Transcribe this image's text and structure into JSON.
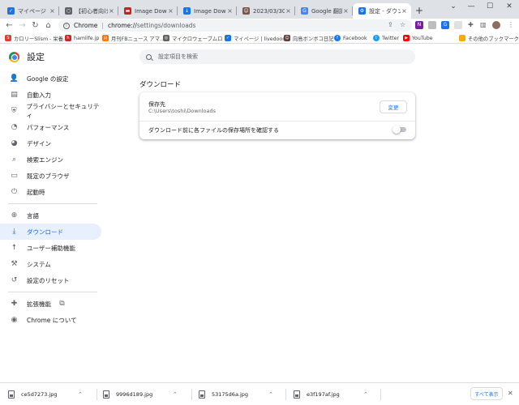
{
  "tabs": [
    {
      "title": "マイページ | live",
      "favicon_color": "#1a73e8",
      "favicon_glyph": "✓"
    },
    {
      "title": "【初心者向け】ロ",
      "favicon_color": "#5f6368",
      "favicon_glyph": "○"
    },
    {
      "title": "Image Downlo",
      "favicon_color": "#c5221f",
      "favicon_glyph": "▬"
    },
    {
      "title": "Image Downlo",
      "favicon_color": "#1a73e8",
      "favicon_glyph": "↓"
    },
    {
      "title": "2023/03/30ー",
      "favicon_color": "#795548",
      "favicon_glyph": "☺"
    },
    {
      "title": "Google 翻訳",
      "favicon_color": "#4285f4",
      "favicon_glyph": "G"
    },
    {
      "title": "設定 - ダウンロ",
      "favicon_color": "#1a73e8",
      "favicon_glyph": "⚙"
    }
  ],
  "toolbar": {
    "scheme": "Chrome",
    "host": "chrome://",
    "path": "settings/downloads",
    "extensions": [
      {
        "color": "#7b1fa2",
        "glyph": "N"
      },
      {
        "color": "#bdbdbd",
        "glyph": ""
      },
      {
        "color": "#1a73e8",
        "glyph": "G"
      },
      {
        "color": "#e0e0e0",
        "glyph": ""
      }
    ]
  },
  "bookmarks": [
    {
      "label": "カロリーSlism - 栄養...",
      "color": "#e53935",
      "glyph": "S"
    },
    {
      "label": "hamlife.jp",
      "color": "#c62828",
      "glyph": "h"
    },
    {
      "label": "月刊FBニュース  アマ...",
      "color": "#ff6f00",
      "glyph": "月"
    },
    {
      "label": "マイクロウェーブムロ -...",
      "color": "#616161",
      "glyph": "◎"
    },
    {
      "label": "マイページ | livedoor...",
      "color": "#1a73e8",
      "glyph": "✓"
    },
    {
      "label": "向島ボンボコ日記",
      "color": "#5d4037",
      "glyph": "☺"
    },
    {
      "label": "Facebook",
      "color": "#1877f2",
      "glyph": "f"
    },
    {
      "label": "Twitter",
      "color": "#1d9bf0",
      "glyph": "t"
    },
    {
      "label": "YouTube",
      "color": "#ff0000",
      "glyph": "▶"
    },
    {
      "label": "その他のブックマーク",
      "color": "#f9ab00",
      "glyph": "■"
    }
  ],
  "settings": {
    "title": "設定",
    "search_placeholder": "設定項目を検索"
  },
  "sidebar": {
    "items": [
      {
        "label": "Google の設定",
        "icon": "person-icon"
      },
      {
        "label": "自動入力",
        "icon": "clipboard-icon"
      },
      {
        "label": "プライバシーとセキュリティ",
        "icon": "shield-icon"
      },
      {
        "label": "パフォーマンス",
        "icon": "speedometer-icon"
      },
      {
        "label": "デザイン",
        "icon": "palette-icon"
      },
      {
        "label": "検索エンジン",
        "icon": "search-icon"
      },
      {
        "label": "既定のブラウザ",
        "icon": "browser-icon"
      },
      {
        "label": "起動時",
        "icon": "power-icon"
      },
      {
        "label": "言語",
        "icon": "globe-icon"
      },
      {
        "label": "ダウンロード",
        "icon": "download-icon"
      },
      {
        "label": "ユーザー補助機能",
        "icon": "accessibility-icon"
      },
      {
        "label": "システム",
        "icon": "wrench-icon"
      },
      {
        "label": "設定のリセット",
        "icon": "history-icon"
      },
      {
        "label": "拡張機能",
        "icon": "puzzle-icon"
      },
      {
        "label": "Chrome について",
        "icon": "chrome-icon"
      }
    ]
  },
  "downloads": {
    "section_title": "ダウンロード",
    "location_label": "保存先",
    "location_path": "C:\\Users\\toshi\\Downloads",
    "change_label": "変更",
    "ask_label": "ダウンロード前に各ファイルの保存場所を確認する"
  },
  "shelf": {
    "files": [
      "ce5d7273.jpg",
      "9996d189.jpg",
      "53175d6a.jpg",
      "e3f197af.jpg"
    ],
    "show_all": "すべて表示"
  },
  "colors": {
    "accent": "#1a73e8",
    "selected_bg": "#e8f0fe"
  }
}
